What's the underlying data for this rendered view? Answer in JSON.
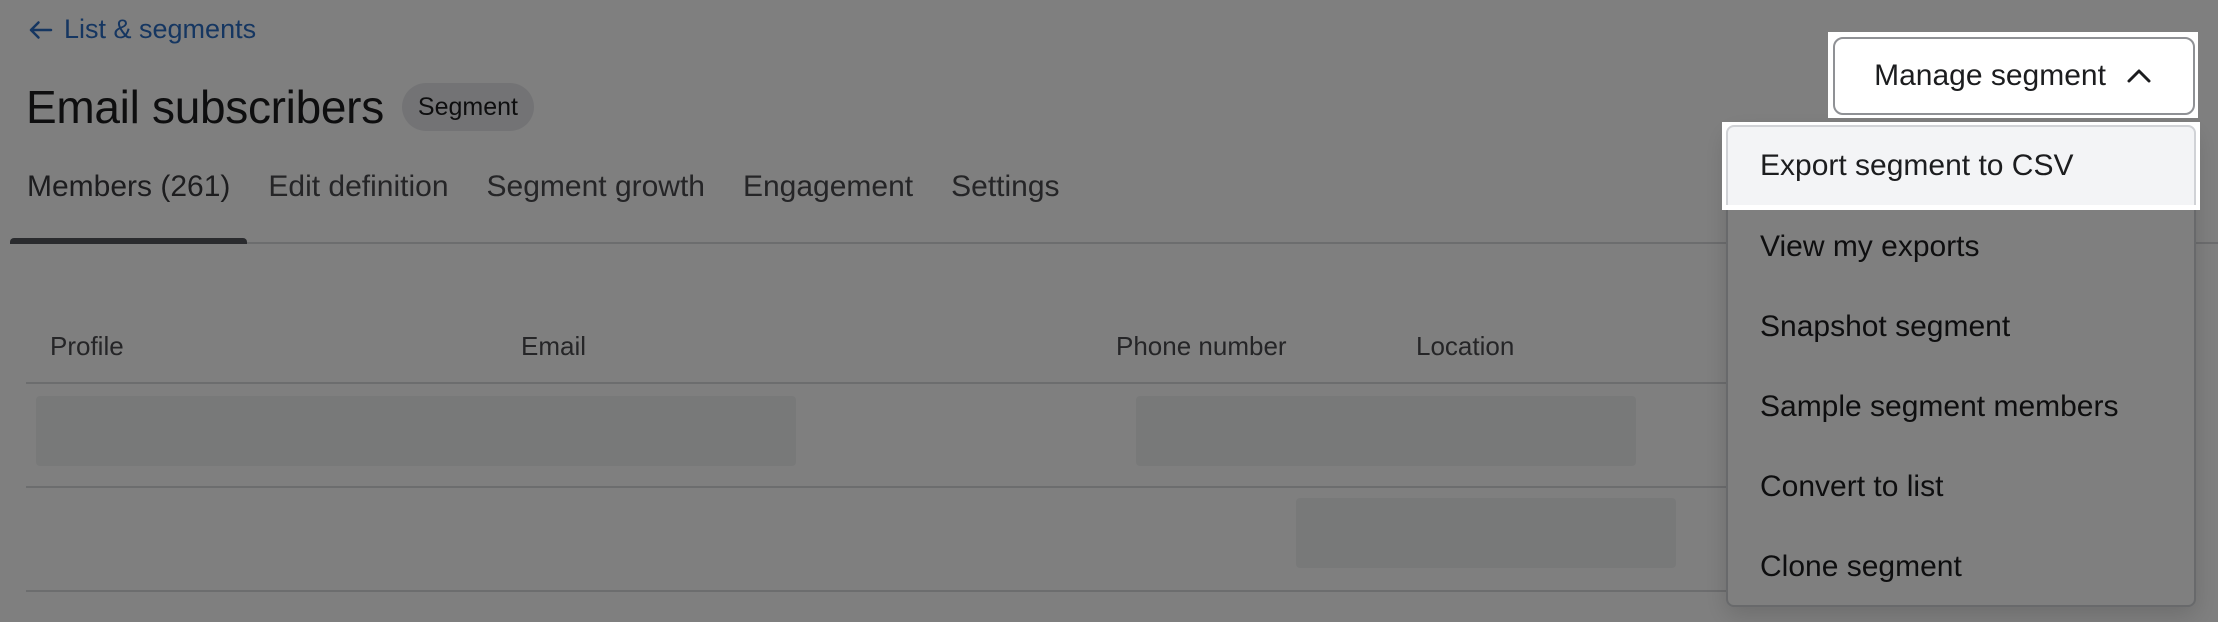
{
  "breadcrumb": {
    "back_label": "List & segments",
    "icon": "arrow-left-icon"
  },
  "header": {
    "title": "Email subscribers",
    "badge": "Segment"
  },
  "tabs": [
    {
      "label": "Members (261)",
      "active": true
    },
    {
      "label": "Edit definition",
      "active": false
    },
    {
      "label": "Segment growth",
      "active": false
    },
    {
      "label": "Engagement",
      "active": false
    },
    {
      "label": "Settings",
      "active": false
    }
  ],
  "table": {
    "columns": [
      "Profile",
      "Email",
      "Phone number",
      "Location"
    ],
    "rows_loading": 2
  },
  "manage_menu": {
    "button_label": "Manage segment",
    "button_icon": "chevron-up-icon",
    "expanded": true,
    "highlighted_item": "Export segment to CSV",
    "items": [
      "Export segment to CSV",
      "View my exports",
      "Snapshot segment",
      "Sample segment members",
      "Convert to list",
      "Clone segment"
    ]
  },
  "colors": {
    "link": "#2a6cc2",
    "overlay": "rgba(0,0,0,0.5)",
    "highlight_item_bg": "#f3f4f6"
  }
}
